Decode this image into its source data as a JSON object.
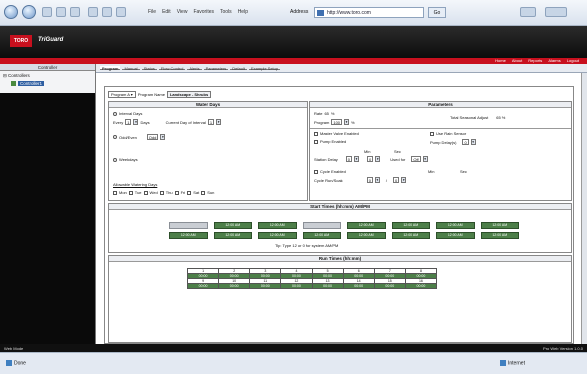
{
  "browser": {
    "menus": [
      "File",
      "Edit",
      "View",
      "Favorites",
      "Tools",
      "Help"
    ],
    "address_label": "Address",
    "address": "http://www.toro.com",
    "go": "Go"
  },
  "app": {
    "brand": "TORO",
    "product": "TriGuard",
    "topnav": [
      "Home",
      "About",
      "Reports",
      "Alarms",
      "Logout"
    ]
  },
  "sidebar": {
    "header": "Controller",
    "root": "Controllers",
    "item": "Controller1"
  },
  "tabs": [
    "Program",
    "Manual",
    "Status",
    "Flow Control",
    "Alerts",
    "Parameters",
    "Default",
    "Example Setup"
  ],
  "program": {
    "select": "Program A",
    "name_label": "Program Name",
    "name_value": "Landscape - Shrubs"
  },
  "water_days": {
    "title": "Water Days",
    "interval_label": "Interval Days",
    "every_label": "Every",
    "every_value": "1",
    "days_label": "Days",
    "current_label": "Current Day of Interval",
    "current_value": "1",
    "odd_even_label": "Odd/Even",
    "odd_value": "Odd",
    "weekdays_label": "Weekdays",
    "exclusion_label": "Allowable Watering Days",
    "days": [
      "Mon",
      "Tue",
      "Wed",
      "Thu",
      "Fri",
      "Sat",
      "Sun"
    ]
  },
  "parameters": {
    "title": "Parameters",
    "rate_label": "Rate",
    "rate_value": "65",
    "rate_unit": "%",
    "program_label": "Program",
    "program_value": "100",
    "program_unit": "%",
    "total_label": "Total Seasonal Adjust",
    "total_value": "65 %",
    "master_valve": "Master Valve Enabled",
    "use_rain": "Use Rain Sensor",
    "pump_enabled": "Pump Enabled",
    "pump_delay_label": "Pump Delay(s)",
    "pump_delay_value": "0",
    "min_label": "Min",
    "sec_label": "Sec",
    "station_delay_label": "Station Delay",
    "station_delay_min": "0",
    "station_delay_sec": "0",
    "used_for_label": "Used for",
    "used_for_value": "Off",
    "cycle_enabled": "Cycle Enabled",
    "cycle_label": "Cycle Run/Soak",
    "cycle_run": "0",
    "cycle_soak": "0"
  },
  "start_times": {
    "title": "Start Times (hh:mm) AM/PM",
    "times": [
      "",
      "12:00 AM",
      "12:00 AM",
      "",
      "12:00 AM",
      "12:00 AM",
      "12:00 AM",
      "12:00 AM",
      "12:00 AM",
      "12:00 AM",
      "12:00 AM",
      "12:00 AM",
      "12:00 AM",
      "12:00 AM",
      "12:00 AM",
      "12:00 AM"
    ],
    "note": "Tip: Type 12 or 0 for system AM/PM"
  },
  "run_times": {
    "title": "Run Times (hh:mm)",
    "stations_row1": [
      "1",
      "2",
      "3",
      "4",
      "5",
      "6",
      "7",
      "8"
    ],
    "values_row1": [
      "00:00",
      "00:00",
      "00:00",
      "00:00",
      "00:00",
      "00:00",
      "00:00",
      "00:00"
    ],
    "stations_row2": [
      "9",
      "10",
      "11",
      "12",
      "13",
      "14",
      "15",
      "16"
    ],
    "values_row2": [
      "00:00",
      "00:00",
      "00:00",
      "00:00",
      "00:00",
      "00:00",
      "00:00",
      "00:00"
    ]
  },
  "status_strip": {
    "left": "Web Mode",
    "right": "Pro Web Version 1.0.0"
  },
  "ie_status": {
    "left": "Done",
    "right": "Internet"
  }
}
